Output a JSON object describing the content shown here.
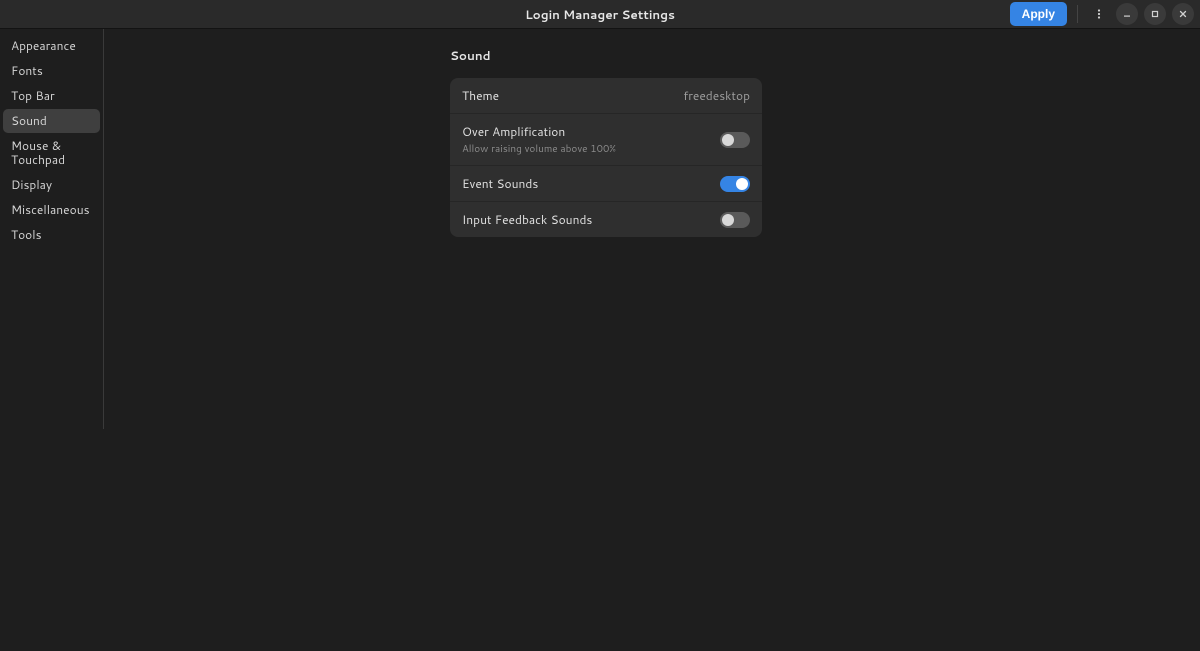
{
  "header": {
    "title": "Login Manager Settings",
    "apply_label": "Apply"
  },
  "sidebar": {
    "items": [
      {
        "label": "Appearance",
        "selected": false
      },
      {
        "label": "Fonts",
        "selected": false
      },
      {
        "label": "Top Bar",
        "selected": false
      },
      {
        "label": "Sound",
        "selected": true
      },
      {
        "label": "Mouse & Touchpad",
        "selected": false
      },
      {
        "label": "Display",
        "selected": false
      },
      {
        "label": "Miscellaneous",
        "selected": false
      },
      {
        "label": "Tools",
        "selected": false
      }
    ]
  },
  "content": {
    "section_title": "Sound",
    "theme": {
      "label": "Theme",
      "value": "freedesktop"
    },
    "over_amp": {
      "label": "Over Amplification",
      "subtitle": "Allow raising volume above 100%",
      "on": false
    },
    "event_sounds": {
      "label": "Event Sounds",
      "on": true
    },
    "input_feedback": {
      "label": "Input Feedback Sounds",
      "on": false
    }
  }
}
